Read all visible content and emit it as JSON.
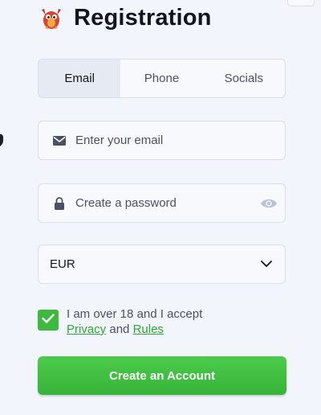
{
  "header": {
    "title": "Registration",
    "logo_icon": "bird-mascot-icon"
  },
  "tabs": [
    {
      "label": "Email",
      "active": true
    },
    {
      "label": "Phone",
      "active": false
    },
    {
      "label": "Socials",
      "active": false
    }
  ],
  "email": {
    "placeholder": "Enter your email",
    "value": "",
    "icon": "envelope-icon"
  },
  "password": {
    "placeholder": "Create a password",
    "value": "",
    "icon": "lock-icon",
    "toggle_icon": "eye-icon"
  },
  "currency": {
    "selected": "EUR",
    "icon": "chevron-down-icon"
  },
  "consent": {
    "checked": true,
    "text_before": "I am over 18 and I accept",
    "privacy_link": "Privacy",
    "and_text": "and",
    "rules_link": "Rules"
  },
  "submit": {
    "label": "Create an Account"
  },
  "colors": {
    "accent_green": "#3db93d",
    "background": "#f2f5fb",
    "text_dark": "#111522"
  }
}
